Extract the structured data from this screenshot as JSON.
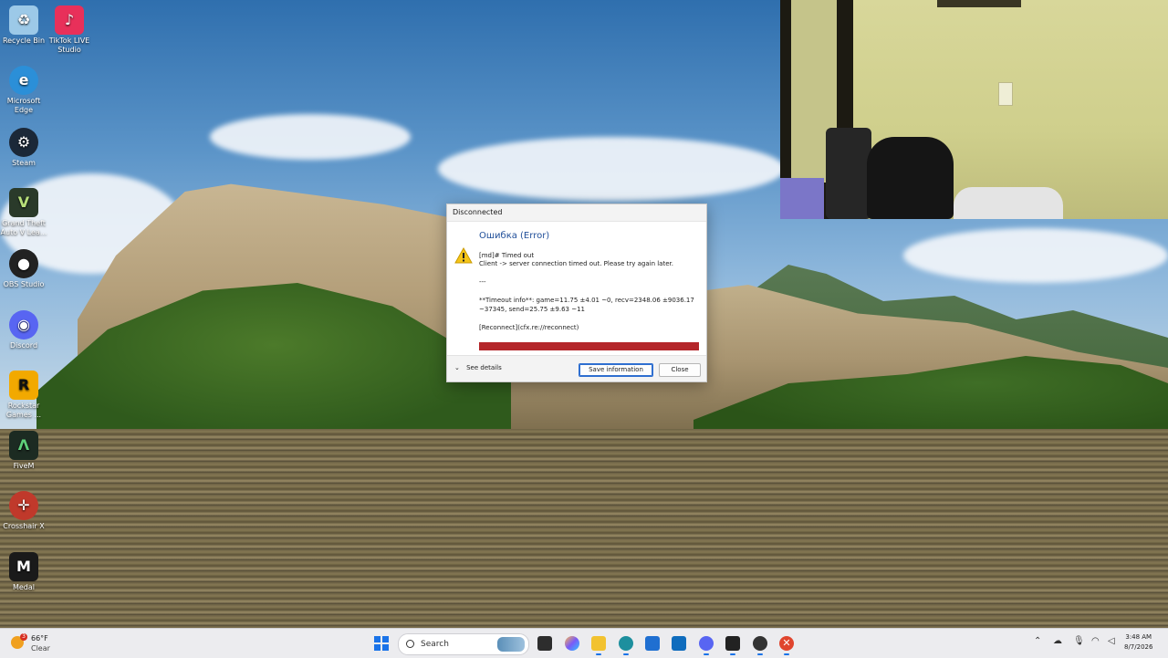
{
  "desktop": {
    "icons": [
      {
        "label": "Recycle Bin",
        "icon": "recycle-bin-icon",
        "color": "#9cc9e8",
        "glyph": "♻"
      },
      {
        "label": "TikTok LIVE Studio",
        "icon": "tiktok-icon",
        "color": "#e8305a",
        "glyph": "♪"
      },
      {
        "label": "Microsoft Edge",
        "icon": "edge-icon",
        "color": "#2b8fd8",
        "glyph": "e"
      },
      {
        "label": "Steam",
        "icon": "steam-icon",
        "color": "#1b2838",
        "glyph": "⚙"
      },
      {
        "label": "Grand Theft Auto V Lea...",
        "icon": "gta-v-icon",
        "color": "#2a3a2a",
        "glyph": "V"
      },
      {
        "label": "OBS Studio",
        "icon": "obs-icon",
        "color": "#222222",
        "glyph": "●"
      },
      {
        "label": "Discord",
        "icon": "discord-icon",
        "color": "#5865f2",
        "glyph": "◉"
      },
      {
        "label": "Rockstar Games ...",
        "icon": "rockstar-icon",
        "color": "#f2a900",
        "glyph": "R"
      },
      {
        "label": "FiveM",
        "icon": "fivem-icon",
        "color": "#1c2b22",
        "glyph": "Λ"
      },
      {
        "label": "Crosshair X",
        "icon": "crosshair-icon",
        "color": "#c0392b",
        "glyph": "✛"
      },
      {
        "label": "Medal",
        "icon": "medal-icon",
        "color": "#1a1a1a",
        "glyph": "M"
      }
    ]
  },
  "dialog": {
    "title": "Disconnected",
    "heading": "Ошибка (Error)",
    "lines": [
      "[md]# Timed out",
      "Client -> server connection timed out. Please try again later.",
      "---",
      "**Timeout info**: game=11.75 ±4.01 ~0, recv=2348.06 ±9036.17",
      "~37345, send=25.75 ±9.63 ~11",
      "[Reconnect](cfx.re://reconnect)"
    ],
    "see_details": "See details",
    "save_button": "Save information",
    "close_button": "Close",
    "accent_color": "#b4262a"
  },
  "taskbar": {
    "weather": {
      "temp": "66°F",
      "condition": "Clear",
      "badge": "3"
    },
    "search_placeholder": "Search",
    "apps": [
      {
        "icon": "file-explorer-icon",
        "color": "#2d2d2d"
      },
      {
        "icon": "copilot-icon",
        "color": "#7a5af8"
      },
      {
        "icon": "folder-icon",
        "color": "#f2c230"
      },
      {
        "icon": "edge-icon",
        "color": "#1d8f9e"
      },
      {
        "icon": "store-icon",
        "color": "#1f6fd1"
      },
      {
        "icon": "outlook-icon",
        "color": "#0f6cbd"
      },
      {
        "icon": "discord-icon",
        "color": "#5865f2"
      },
      {
        "icon": "medal-icon",
        "color": "#222222"
      },
      {
        "icon": "obs-icon",
        "color": "#333333"
      },
      {
        "icon": "fivem-error-icon",
        "color": "#e0452e"
      }
    ],
    "clock": {
      "time": "3:48 AM",
      "date": "8/7/2026"
    }
  }
}
